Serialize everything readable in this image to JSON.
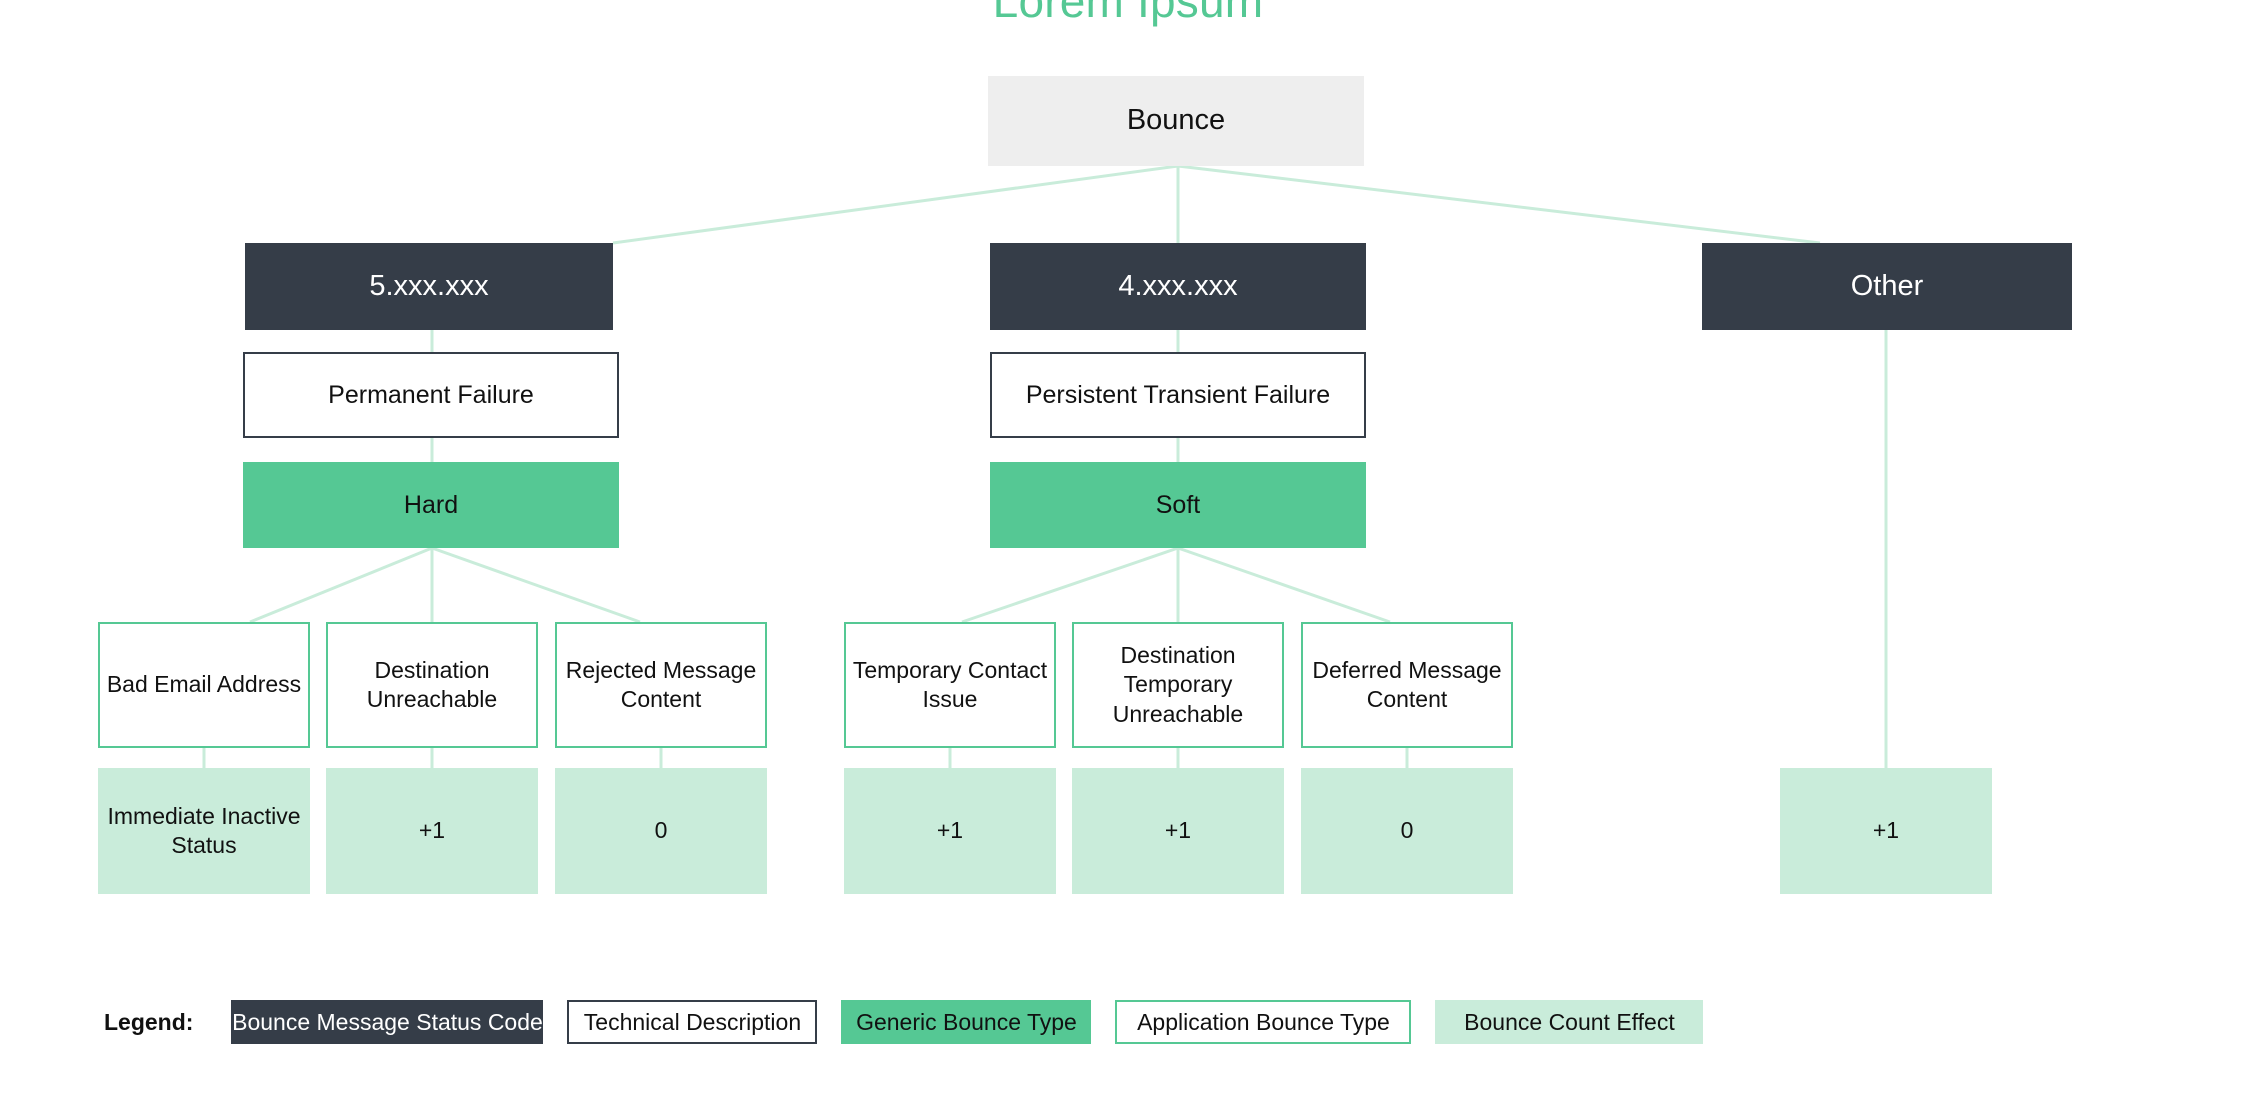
{
  "title": "Lorem Ipsum",
  "colors": {
    "accent_green": "#55c894",
    "light_green": "#c9ecda",
    "dark_slate": "#353d48",
    "root_gray": "#eeeeee",
    "connector": "#c9ecda"
  },
  "root": {
    "label": "Bounce"
  },
  "status_codes": [
    {
      "label": "5.xxx.xxx"
    },
    {
      "label": "4.xxx.xxx"
    },
    {
      "label": "Other"
    }
  ],
  "technical_descriptions": [
    {
      "label": "Permanent Failure"
    },
    {
      "label": "Persistent Transient Failure"
    }
  ],
  "generic_types": [
    {
      "label": "Hard"
    },
    {
      "label": "Soft"
    }
  ],
  "application_types": [
    {
      "label": "Bad Email Address"
    },
    {
      "label": "Destination Unreachable"
    },
    {
      "label": "Rejected Message Content"
    },
    {
      "label": "Temporary Contact Issue"
    },
    {
      "label": "Destination Temporary Unreachable"
    },
    {
      "label": "Deferred Message Content"
    }
  ],
  "count_effects": [
    {
      "label": "Immediate Inactive Status"
    },
    {
      "label": "+1"
    },
    {
      "label": "0"
    },
    {
      "label": "+1"
    },
    {
      "label": "+1"
    },
    {
      "label": "0"
    },
    {
      "label": "+1"
    }
  ],
  "legend": {
    "label": "Legend:",
    "items": [
      {
        "label": "Bounce Message Status Code",
        "style": "status"
      },
      {
        "label": "Technical Description",
        "style": "tech"
      },
      {
        "label": "Generic Bounce Type",
        "style": "generic"
      },
      {
        "label": "Application Bounce Type",
        "style": "app"
      },
      {
        "label": "Bounce Count Effect",
        "style": "count"
      }
    ]
  }
}
